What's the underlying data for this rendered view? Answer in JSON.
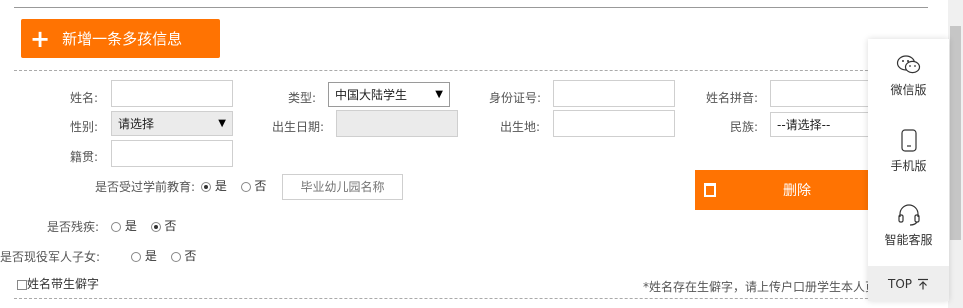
{
  "add_button": {
    "icon": "plus-icon",
    "label": "新增一条多孩信息"
  },
  "fields": {
    "name": {
      "label": "姓名:",
      "value": ""
    },
    "type": {
      "label": "类型:",
      "value": "中国大陆学生"
    },
    "id_number": {
      "label": "身份证号:",
      "value": ""
    },
    "pinyin": {
      "label": "姓名拼音:",
      "value": ""
    },
    "gender": {
      "label": "性别:",
      "value": "请选择"
    },
    "birth_date": {
      "label": "出生日期:",
      "value": ""
    },
    "birthplace": {
      "label": "出生地:",
      "value": ""
    },
    "ethnicity": {
      "label": "民族:",
      "value": "--请选择--"
    },
    "native_place": {
      "label": "籍贯:",
      "value": ""
    }
  },
  "preschool": {
    "label": "是否受过学前教育:",
    "yes": "是",
    "no": "否",
    "selected": "yes",
    "kindergarten_placeholder": "毕业幼儿园名称"
  },
  "disability": {
    "label": "是否残疾:",
    "yes": "是",
    "no": "否",
    "selected": "no"
  },
  "military": {
    "label": "是否现役军人子女:",
    "yes": "是",
    "no": "否",
    "selected": "none"
  },
  "rare_char": {
    "label": "姓名带生僻字",
    "checked": false
  },
  "note": "*姓名存在生僻字，请上传户口册学生本人页",
  "delete_button": {
    "icon": "trash-icon",
    "label": "删除"
  },
  "sidebar": {
    "wechat": "微信版",
    "mobile": "手机版",
    "service": "智能客服",
    "top": "TOP",
    "top_icon": "arrow-up-to-line-icon"
  },
  "colors": {
    "accent": "#ff7302",
    "field_border": "#cfcfcf"
  }
}
